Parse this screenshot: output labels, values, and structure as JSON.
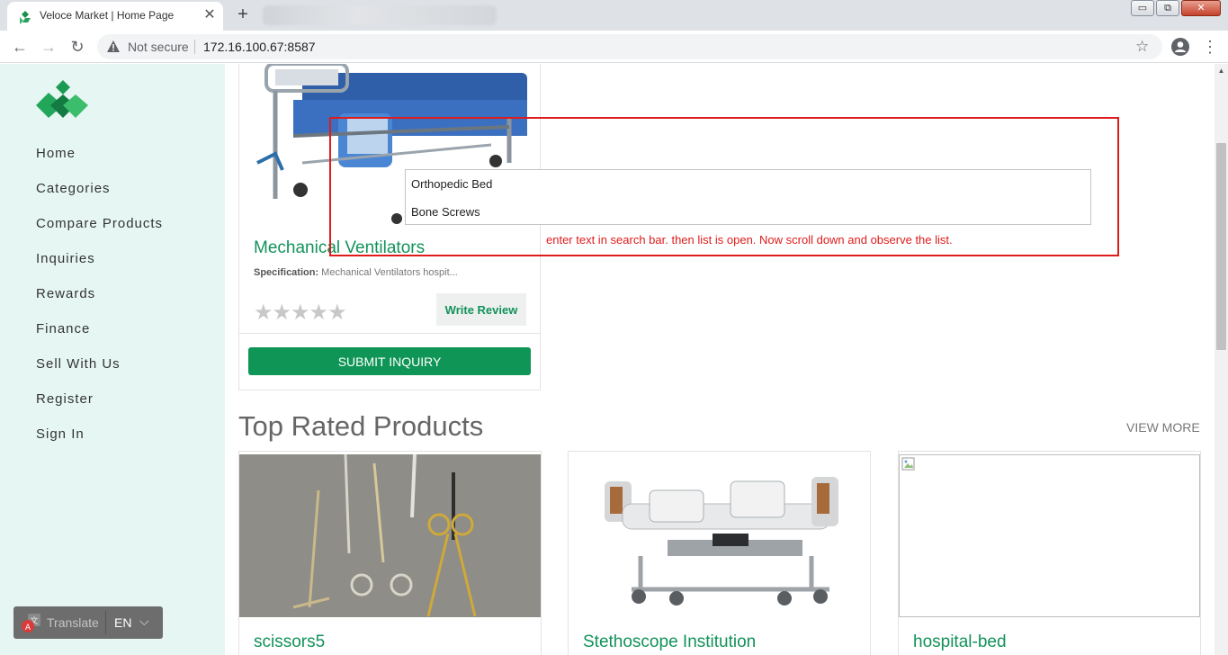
{
  "browser": {
    "tab_title": "Veloce Market | Home Page",
    "tab_close": "✕",
    "new_tab": "+",
    "security_label": "Not secure",
    "url": "172.16.100.67:8587",
    "window_controls": {
      "minimize": "▭",
      "restore": "⧉",
      "close": "✕"
    }
  },
  "sidebar": {
    "items": [
      {
        "label": "Home"
      },
      {
        "label": "Categories"
      },
      {
        "label": "Compare Products"
      },
      {
        "label": "Inquiries"
      },
      {
        "label": "Rewards"
      },
      {
        "label": "Finance"
      },
      {
        "label": "Sell With Us"
      },
      {
        "label": "Register"
      },
      {
        "label": "Sign In"
      }
    ]
  },
  "translate_widget": {
    "label": "Translate",
    "language": "EN",
    "caret": "⌵"
  },
  "featured_card": {
    "title": "Mechanical Ventilators",
    "spec_label": "Specification:",
    "spec_value": " Mechanical Ventilators hospit...",
    "rating_stars": "★★★★★",
    "rating_value": 0,
    "review_button": "Write Review",
    "inquiry_button": "SUBMIT INQUIRY"
  },
  "top_rated": {
    "heading": "Top Rated Products",
    "view_more": "VIEW MORE",
    "products": [
      {
        "title": "scissors5"
      },
      {
        "title": "Stethoscope Institution"
      },
      {
        "title": "hospital-bed"
      }
    ]
  },
  "search_suggestions": {
    "items": [
      "Orthopedic Bed",
      "Bone Screws"
    ]
  },
  "annotation": {
    "note": "enter text in search bar. then list is open. Now scroll down and observe the list.",
    "color": "#e01b1b"
  },
  "colors": {
    "brand_green": "#12925a",
    "button_green": "#0f9556",
    "sidebar_bg": "#e6f7f3"
  }
}
